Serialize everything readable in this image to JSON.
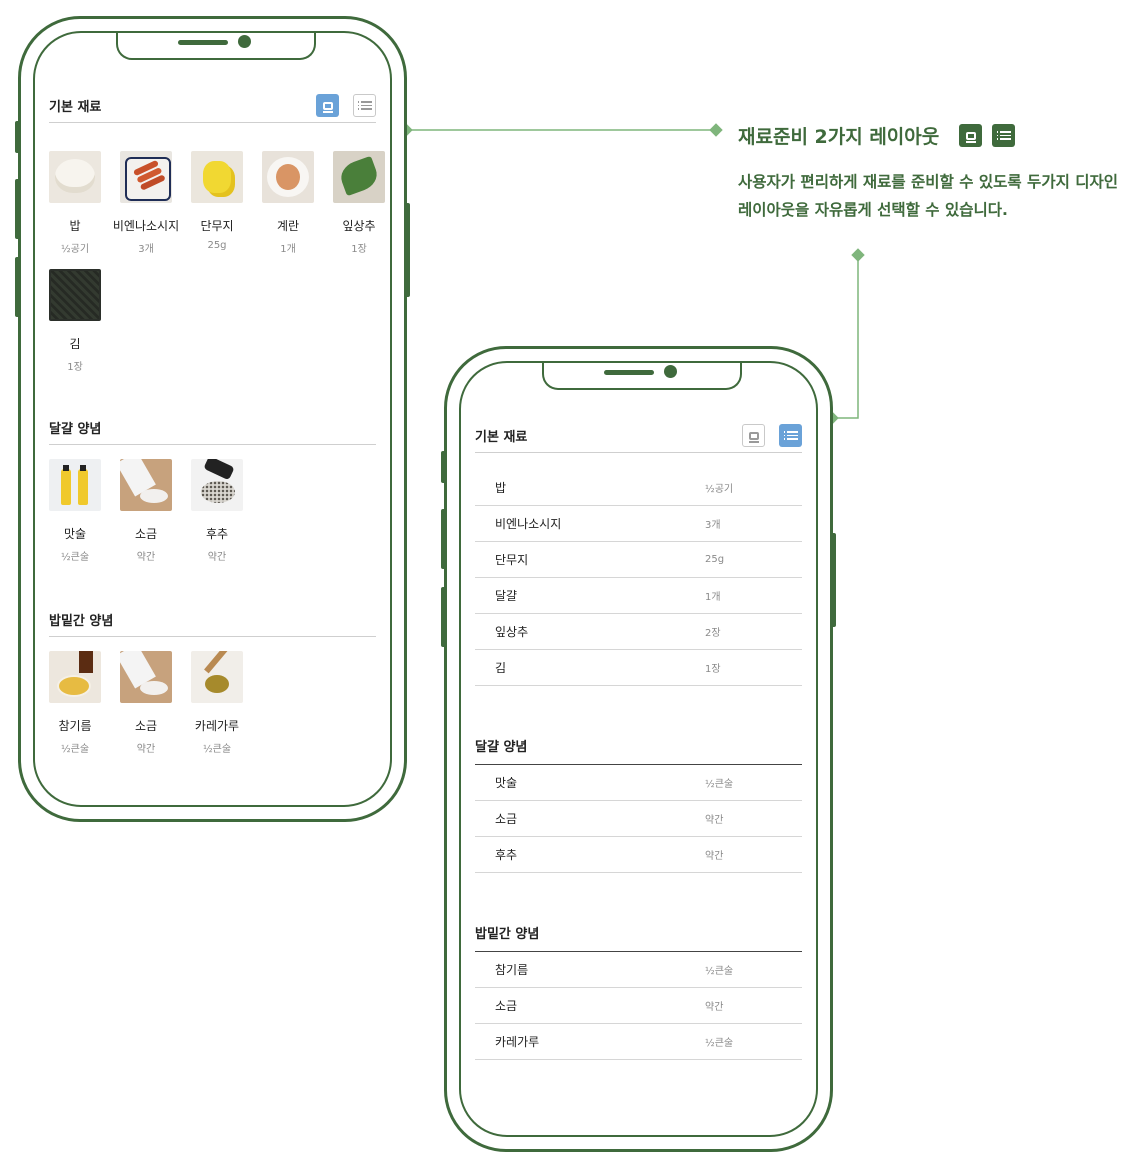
{
  "annotation": {
    "title": "재료준비 2가지 레이아웃",
    "description": "사용자가 편리하게 재료를 준비할 수 있도록 두가지 디자인 레이아웃을 자유롭게 선택할 수 있습니다."
  },
  "card_view": {
    "sections": [
      {
        "title": "기본 재료",
        "items": [
          {
            "name": "밥",
            "qty": "½공기",
            "icon": "rice-bowl-image"
          },
          {
            "name": "비엔나소시지",
            "qty": "3개",
            "icon": "sausage-image"
          },
          {
            "name": "단무지",
            "qty": "25g",
            "icon": "pickled-radish-image"
          },
          {
            "name": "계란",
            "qty": "1개",
            "icon": "egg-image"
          },
          {
            "name": "잎상추",
            "qty": "1장",
            "icon": "lettuce-image"
          },
          {
            "name": "김",
            "qty": "1장",
            "icon": "laver-image"
          }
        ]
      },
      {
        "title": "달걀 양념",
        "items": [
          {
            "name": "맛술",
            "qty": "½큰술",
            "icon": "mirin-image"
          },
          {
            "name": "소금",
            "qty": "약간",
            "icon": "salt-image"
          },
          {
            "name": "후추",
            "qty": "약간",
            "icon": "pepper-image"
          }
        ]
      },
      {
        "title": "밥밑간 양념",
        "items": [
          {
            "name": "참기름",
            "qty": "½큰술",
            "icon": "sesame-oil-image"
          },
          {
            "name": "소금",
            "qty": "약간",
            "icon": "salt-image"
          },
          {
            "name": "카레가루",
            "qty": "½큰술",
            "icon": "curry-powder-image"
          }
        ]
      }
    ]
  },
  "list_view": {
    "sections": [
      {
        "title": "기본 재료",
        "items": [
          {
            "name": "밥",
            "qty": "½공기"
          },
          {
            "name": "비엔나소시지",
            "qty": "3개"
          },
          {
            "name": "단무지",
            "qty": "25g"
          },
          {
            "name": "달걀",
            "qty": "1개"
          },
          {
            "name": "잎상추",
            "qty": "2장"
          },
          {
            "name": "김",
            "qty": "1장"
          }
        ]
      },
      {
        "title": "달걀 양념",
        "items": [
          {
            "name": "맛술",
            "qty": "½큰술"
          },
          {
            "name": "소금",
            "qty": "약간"
          },
          {
            "name": "후추",
            "qty": "약간"
          }
        ]
      },
      {
        "title": "밥밑간 양념",
        "items": [
          {
            "name": "참기름",
            "qty": "½큰술"
          },
          {
            "name": "소금",
            "qty": "약간"
          },
          {
            "name": "카레가루",
            "qty": "½큰술"
          }
        ]
      }
    ]
  },
  "colors": {
    "frame": "#3f6a3c",
    "connector": "#7fb57c",
    "toggle_active": "#6aa2d8"
  },
  "icons": {
    "card_layout": "card-layout-icon",
    "list_layout": "list-layout-icon"
  }
}
